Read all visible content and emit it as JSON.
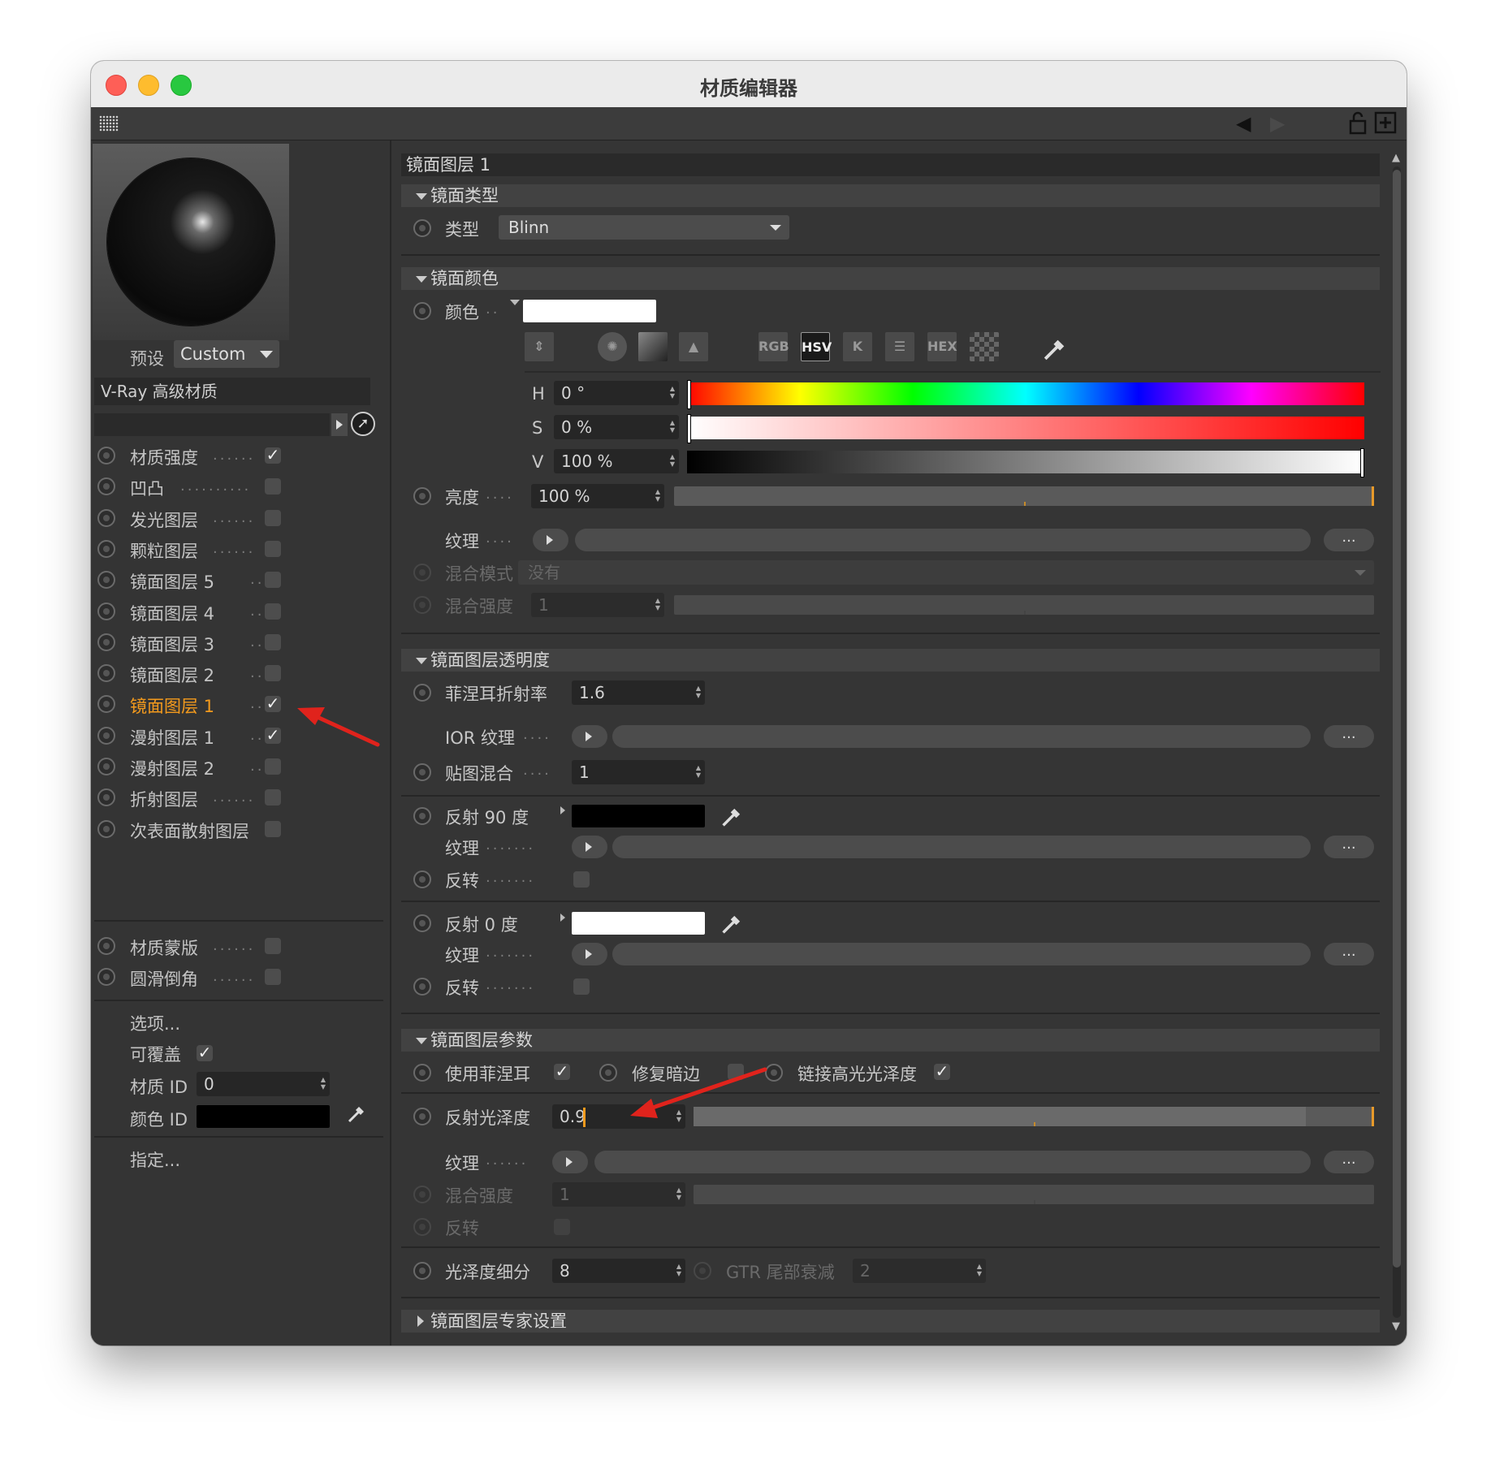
{
  "window": {
    "title": "材质编辑器"
  },
  "preview": {
    "preset_label": "预设",
    "preset_value": "Custom"
  },
  "material": {
    "name": "V-Ray 高级材质"
  },
  "layers": [
    {
      "label": "材质强度",
      "checked": true
    },
    {
      "label": "凹凸",
      "checked": false
    },
    {
      "label": "发光图层",
      "checked": false
    },
    {
      "label": "颗粒图层",
      "checked": false
    },
    {
      "label": "镜面图层 5",
      "checked": false
    },
    {
      "label": "镜面图层 4",
      "checked": false
    },
    {
      "label": "镜面图层 3",
      "checked": false
    },
    {
      "label": "镜面图层 2",
      "checked": false
    },
    {
      "label": "镜面图层 1",
      "checked": true,
      "active": true
    },
    {
      "label": "漫射图层 1",
      "checked": true
    },
    {
      "label": "漫射图层 2",
      "checked": false
    },
    {
      "label": "折射图层",
      "checked": false
    },
    {
      "label": "次表面散射图层",
      "checked": false
    }
  ],
  "extra_layers": [
    {
      "label": "材质蒙版",
      "checked": false
    },
    {
      "label": "圆滑倒角",
      "checked": false
    }
  ],
  "options": {
    "options_label": "选项...",
    "overridable_label": "可覆盖",
    "material_id_label": "材质 ID",
    "material_id_value": "0",
    "color_id_label": "颜色 ID",
    "assign_label": "指定..."
  },
  "panel": {
    "title": "镜面图层 1",
    "spec_type": {
      "header": "镜面类型",
      "type_label": "类型",
      "type_value": "Blinn"
    },
    "spec_color": {
      "header": "镜面颜色",
      "color_label": "颜色",
      "picker_modes": [
        "RGB",
        "HSV",
        "K",
        "HEX"
      ],
      "h_label": "H",
      "h_value": "0 °",
      "s_label": "S",
      "s_value": "0 %",
      "v_label": "V",
      "v_value": "100 %",
      "brightness_label": "亮度",
      "brightness_value": "100 %",
      "texture_label": "纹理",
      "blend_mode_label": "混合模式",
      "blend_mode_value": "没有",
      "blend_strength_label": "混合强度",
      "blend_strength_value": "1",
      "more_label": "..."
    },
    "spec_transparency": {
      "header": "镜面图层透明度",
      "fresnel_ior_label": "菲涅耳折射率",
      "fresnel_ior_value": "1.6",
      "ior_texture_label": "IOR 纹理",
      "map_blend_label": "贴图混合",
      "map_blend_value": "1",
      "refl90_label": "反射 90 度",
      "texture_label": "纹理",
      "invert_label": "反转",
      "refl0_label": "反射 0 度"
    },
    "spec_params": {
      "header": "镜面图层参数",
      "use_fresnel_label": "使用菲涅耳",
      "fix_dark_edges_label": "修复暗边",
      "link_gloss_label": "链接高光光泽度",
      "refl_gloss_label": "反射光泽度",
      "refl_gloss_value": "0.9",
      "texture_label": "纹理",
      "blend_strength_label": "混合强度",
      "blend_strength_value": "1",
      "invert_label": "反转",
      "gloss_subdiv_label": "光泽度细分",
      "gloss_subdiv_value": "8",
      "gtr_label": "GTR 尾部衰减",
      "gtr_value": "2"
    },
    "spec_expert": {
      "header": "镜面图层专家设置"
    }
  },
  "colors": {
    "active_layer": "#f39a1d",
    "annotation_arrow": "#e0231c",
    "spec_color_swatch": "#ffffff",
    "refl90_swatch": "#000000",
    "refl0_swatch": "#ffffff",
    "color_id_swatch": "#000000"
  }
}
